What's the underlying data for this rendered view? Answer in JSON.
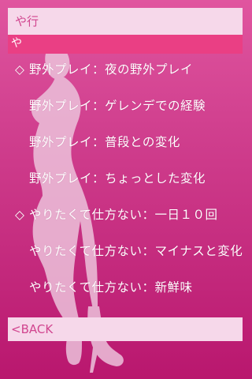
{
  "header": {
    "title": "や行",
    "section_label": "や"
  },
  "menu": {
    "items": [
      {
        "label": "野外プレイ：夜の野外プレイ",
        "marker": "◇"
      },
      {
        "label": "野外プレイ：ゲレンデでの経験",
        "marker": ""
      },
      {
        "label": "野外プレイ：普段との変化",
        "marker": ""
      },
      {
        "label": "野外プレイ：ちょっとした変化",
        "marker": ""
      },
      {
        "label": "やりたくて仕方ない：一日１０回",
        "marker": "◇"
      },
      {
        "label": "やりたくて仕方ない：マイナスと変化",
        "marker": ""
      },
      {
        "label": "やりたくて仕方ない：新鮮味",
        "marker": ""
      }
    ]
  },
  "footer": {
    "back_label": "<BACK"
  },
  "colors": {
    "background_top": "#e0559f",
    "background_bottom": "#b9176e",
    "title_bar": "#f6d8ea",
    "section_bar": "#ea3f84",
    "accent_text": "#d1458f"
  }
}
